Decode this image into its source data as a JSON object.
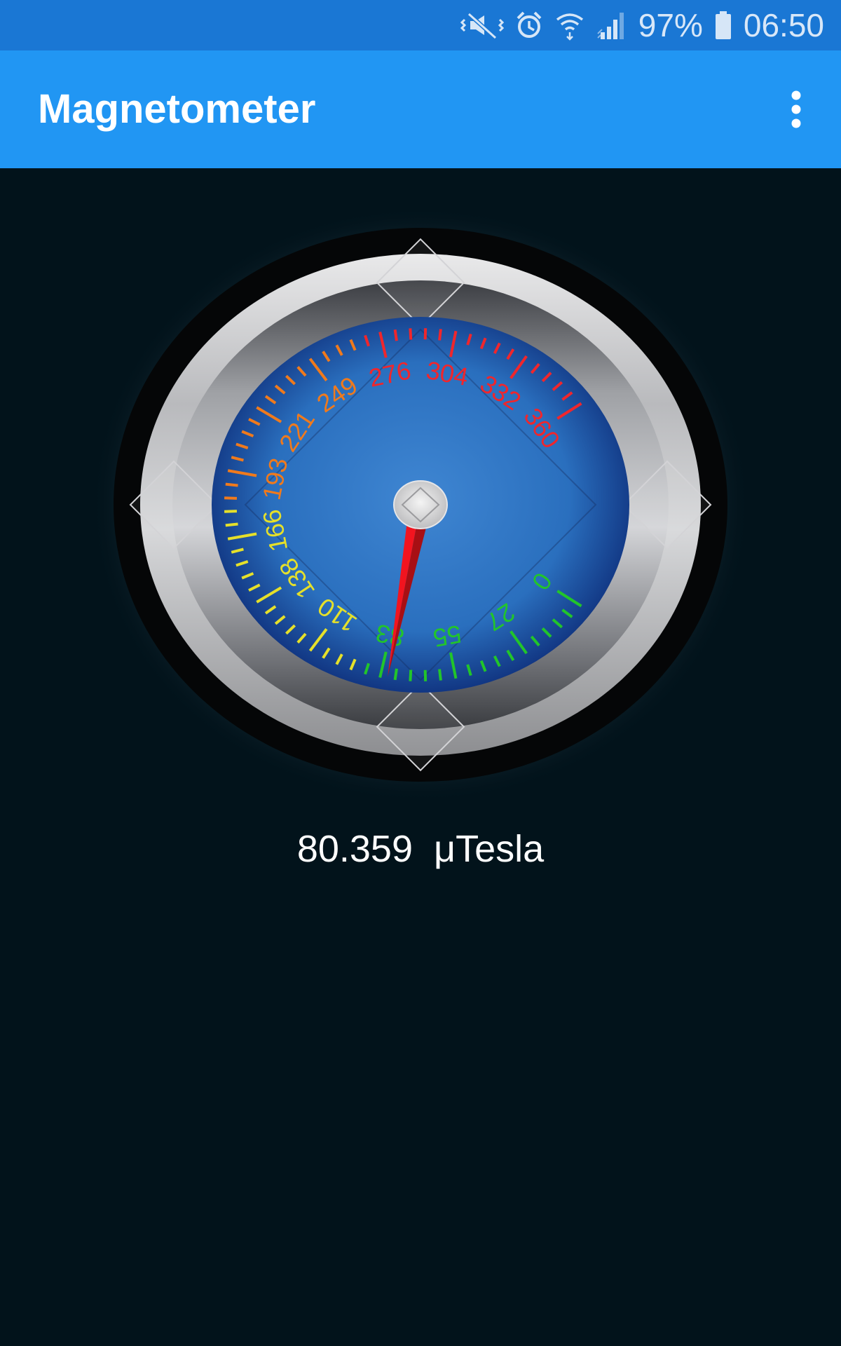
{
  "status_bar": {
    "icons": [
      "mute-vibrate-icon",
      "alarm-icon",
      "wifi-icon",
      "signal-icon",
      "battery-icon"
    ],
    "battery": "97%",
    "time": "06:50"
  },
  "app_bar": {
    "title": "Magnetometer",
    "menu_icon": "more-vert-icon"
  },
  "gauge": {
    "min": 0,
    "max": 360,
    "value": 80.359,
    "scale_labels": [
      "0",
      "27",
      "55",
      "83",
      "110",
      "138",
      "166",
      "193",
      "221",
      "249",
      "276",
      "304",
      "332",
      "360"
    ],
    "zone_colors": [
      "#22c52a",
      "#e5e02a",
      "#f07a1c",
      "#f0262c"
    ],
    "needle_color": "#f2141f",
    "dial_color": "#2a6fbe"
  },
  "reading": {
    "value": "80.359",
    "unit": "μTesla"
  }
}
